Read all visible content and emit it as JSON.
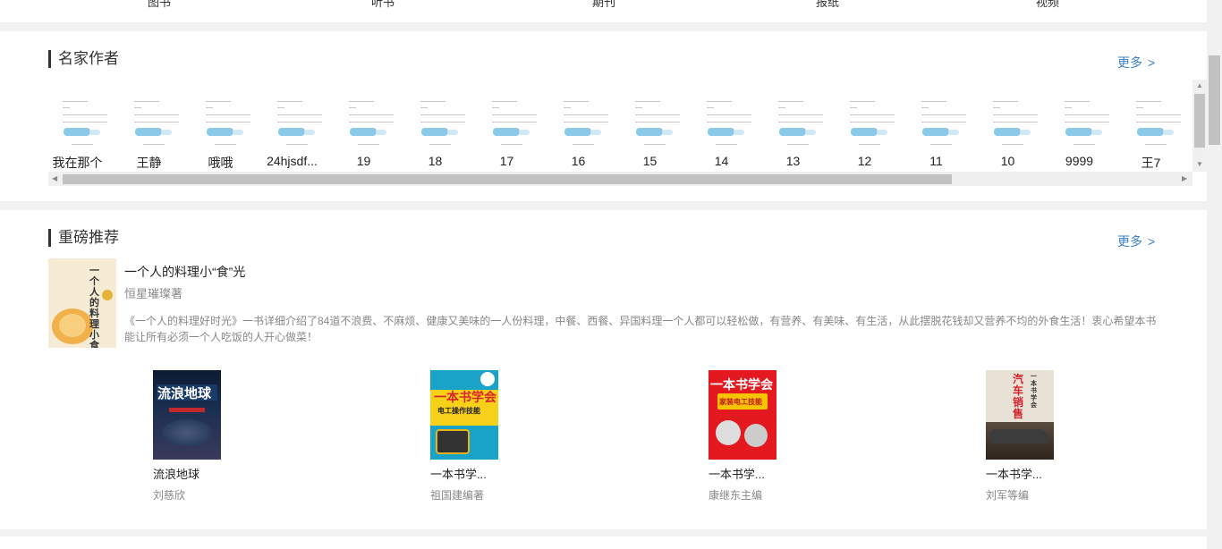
{
  "authors_section": {
    "title": "名家作者",
    "more_label": "更多",
    "authors": [
      {
        "name": "我在那个"
      },
      {
        "name": "王静"
      },
      {
        "name": "哦哦"
      },
      {
        "name": "24hjsdf..."
      },
      {
        "name": "19"
      },
      {
        "name": "18"
      },
      {
        "name": "17"
      },
      {
        "name": "16"
      },
      {
        "name": "15"
      },
      {
        "name": "14"
      },
      {
        "name": "13"
      },
      {
        "name": "12"
      },
      {
        "name": "11"
      },
      {
        "name": "10"
      },
      {
        "name": "9999"
      },
      {
        "name": "王7"
      }
    ]
  },
  "recommend_section": {
    "title": "重磅推荐",
    "more_label": "更多",
    "featured": {
      "title": "一个人的料理小“食”光",
      "author": "恒星璀璨著",
      "description": "《一个人的料理好时光》一书详细介绍了84道不浪费、不麻烦、健康又美味的一人份料理，中餐、西餐、异国料理一个人都可以轻松做，有营养、有美味、有生活，从此摆脱花钱却又营养不均的外食生活！衷心希望本书能让所有必须一个人吃饭的人开心做菜！",
      "cover_text": "一个人的料理小食光"
    },
    "books": [
      {
        "title": "流浪地球",
        "author": "刘慈欣",
        "cover_text": "流浪地球"
      },
      {
        "title": "一本书学...",
        "author": "祖国建编著",
        "cover_text": "一本书学会",
        "cover_sub": "电工操作技能"
      },
      {
        "title": "一本书学...",
        "author": "康继东主编",
        "cover_text": "一本书学会",
        "cover_sub": "家装电工技能"
      },
      {
        "title": "一本书学...",
        "author": "刘军等编",
        "cover_text": "汽车销售",
        "cover_sub": "一本书学会"
      }
    ]
  },
  "colors": {
    "accent": "#3b7fc6",
    "section_bg": "#ffffff",
    "page_bg": "#f2f2f2"
  }
}
